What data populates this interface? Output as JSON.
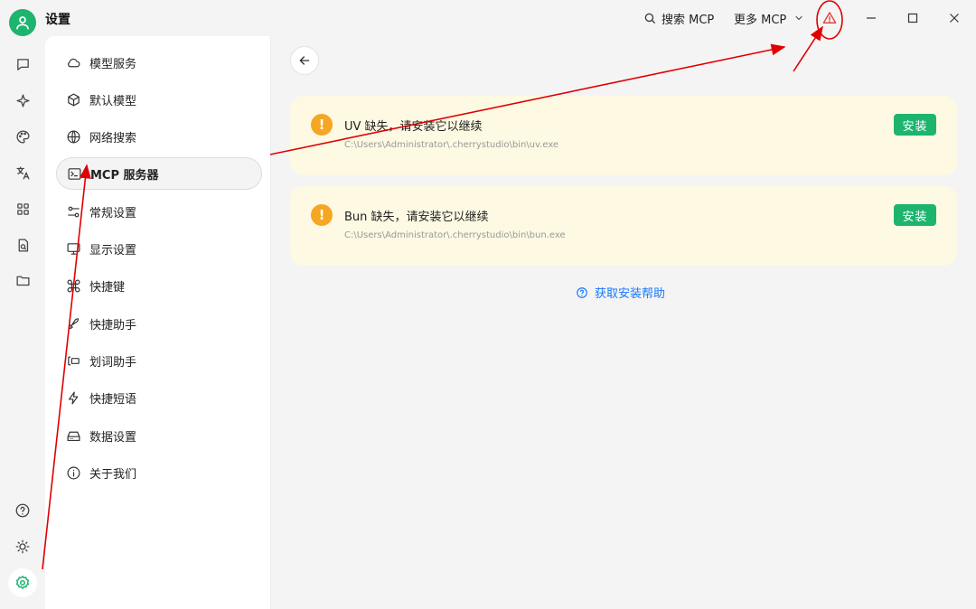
{
  "app": {
    "title": "设置"
  },
  "titlebar": {
    "search_label": "搜索 MCP",
    "more_label": "更多 MCP",
    "icons": [
      "search-icon",
      "chevron-down-icon",
      "warning-triangle-icon",
      "minimize-icon",
      "maximize-icon",
      "close-icon"
    ]
  },
  "rail": {
    "items": [
      "chat-icon",
      "sparkle-icon",
      "palette-icon",
      "translate-icon",
      "apps-grid-icon",
      "document-search-icon",
      "folder-icon"
    ],
    "bottom": [
      "help-icon",
      "theme-icon",
      "settings-icon"
    ]
  },
  "nav": {
    "items": [
      {
        "label": "模型服务",
        "icon": "cloud-icon"
      },
      {
        "label": "默认模型",
        "icon": "cube-icon"
      },
      {
        "label": "网络搜索",
        "icon": "globe-icon"
      },
      {
        "label": "MCP 服务器",
        "icon": "terminal-icon"
      },
      {
        "label": "常规设置",
        "icon": "sliders-icon"
      },
      {
        "label": "显示设置",
        "icon": "monitor-icon"
      },
      {
        "label": "快捷键",
        "icon": "command-icon"
      },
      {
        "label": "快捷助手",
        "icon": "rocket-icon"
      },
      {
        "label": "划词助手",
        "icon": "text-select-icon"
      },
      {
        "label": "快捷短语",
        "icon": "zap-icon"
      },
      {
        "label": "数据设置",
        "icon": "hard-drive-icon"
      },
      {
        "label": "关于我们",
        "icon": "info-icon"
      }
    ],
    "active_index": 3
  },
  "main": {
    "cards": [
      {
        "title": "UV 缺失，请安装它以继续",
        "path": "C:\\Users\\Administrator\\.cherrystudio\\bin\\uv.exe",
        "button": "安装"
      },
      {
        "title": "Bun 缺失，请安装它以继续",
        "path": "C:\\Users\\Administrator\\.cherrystudio\\bin\\bun.exe",
        "button": "安装"
      }
    ],
    "help_link": "获取安装帮助"
  },
  "colors": {
    "accent": "#1db46e",
    "warning": "#f5a623",
    "card_bg": "#fdf9e3",
    "link": "#1677ff",
    "annotation": "#e00000"
  }
}
